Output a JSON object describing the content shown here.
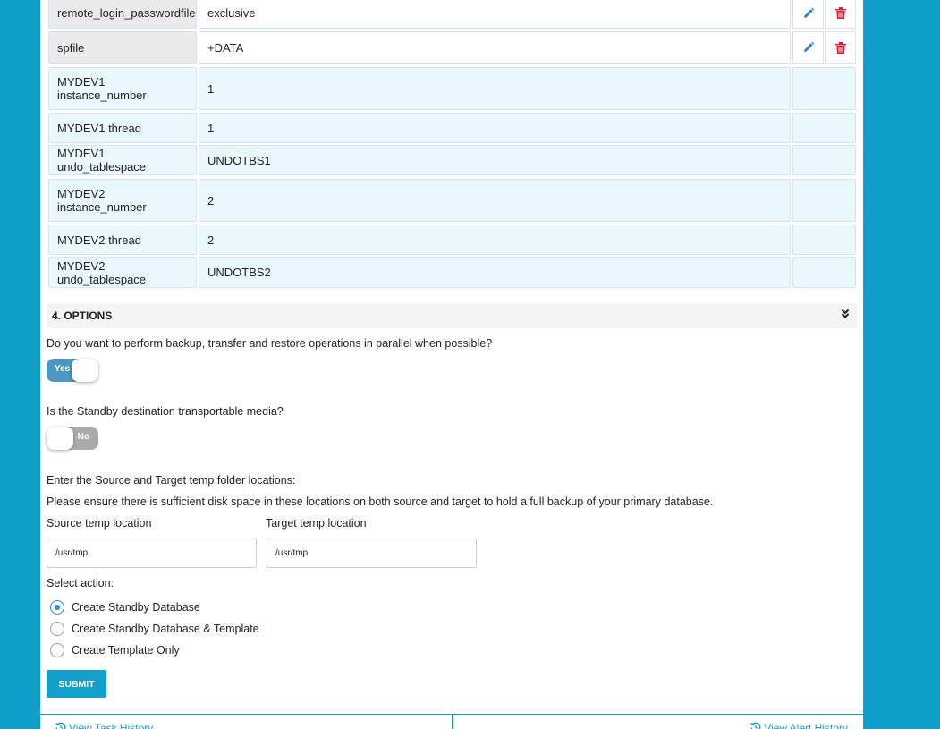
{
  "params": [
    {
      "name": "remote_login_passwordfile",
      "value": "exclusive",
      "type": "default"
    },
    {
      "name": "spfile",
      "value": "+DATA",
      "type": "default"
    },
    {
      "name": "MYDEV1\ninstance_number",
      "value": "1",
      "type": "instance"
    },
    {
      "name": "MYDEV1 thread",
      "value": "1",
      "type": "instance"
    },
    {
      "name": "MYDEV1 undo_tablespace",
      "value": "UNDOTBS1",
      "type": "instance"
    },
    {
      "name": "MYDEV2\ninstance_number",
      "value": "2",
      "type": "instance"
    },
    {
      "name": "MYDEV2 thread",
      "value": "2",
      "type": "instance"
    },
    {
      "name": "MYDEV2 undo_tablespace",
      "value": "UNDOTBS2",
      "type": "instance"
    }
  ],
  "options": {
    "section_title": "4. OPTIONS",
    "parallel_question": "Do you want to perform backup, transfer and restore operations in parallel when possible?",
    "parallel_toggle": "Yes",
    "media_question": "Is the Standby destination transportable media?",
    "media_toggle": "No",
    "temp_intro": "Enter the Source and Target temp folder locations:",
    "temp_note": "Please ensure there is sufficient disk space in these locations on both source and target to hold a full backup of your primary database.",
    "source_label": "Source temp location",
    "source_value": "/usr/tmp",
    "target_label": "Target temp location",
    "target_value": "/usr/tmp",
    "action_label": "Select action:",
    "actions": [
      {
        "label": "Create Standby Database",
        "checked": true
      },
      {
        "label": "Create Standby Database & Template",
        "checked": false
      },
      {
        "label": "Create Template Only",
        "checked": false
      }
    ],
    "submit_label": "SUBMIT"
  },
  "footer": {
    "task_history": "View Task History",
    "alert_history": "View Alert History"
  },
  "colors": {
    "background": "#0f9fc9",
    "edit_icon": "#2a7fc1",
    "delete_icon": "#d71f3a",
    "toggle_on": "#4d97c4",
    "toggle_off": "#aaaaaa",
    "instance_row": "#e9f8fd"
  },
  "icons": {
    "edit": "pencil-icon",
    "delete": "trash-icon",
    "collapse": "chevron-double-down-icon",
    "history": "history-icon"
  }
}
